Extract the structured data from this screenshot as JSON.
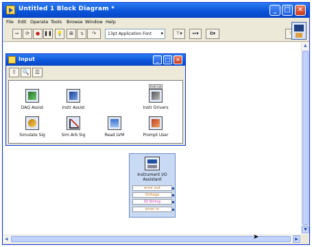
{
  "window": {
    "title": "Untitled 1 Block Diagram *",
    "controls": {
      "minimize": "_",
      "maximize": "□",
      "close": "✕"
    }
  },
  "menubar": [
    "File",
    "Edit",
    "Operate",
    "Tools",
    "Browse",
    "Window",
    "Help"
  ],
  "toolbar": {
    "font_select": "13pt Application Font"
  },
  "palette": {
    "title": "Input",
    "controls": {
      "minimize": "_",
      "maximize": "□",
      "close": "✕"
    },
    "items": [
      {
        "label": "DAQ Assist",
        "icon": "daq-assistant-icon"
      },
      {
        "label": "Instr Assist",
        "icon": "instrument-assistant-icon"
      },
      {
        "label": "Instr Drivers",
        "icon": "instrument-drivers-icon",
        "tag": "Instr Lib"
      },
      {
        "label": "Simulate Sig",
        "icon": "simulate-signal-icon"
      },
      {
        "label": "Sim Arb Sig",
        "icon": "simulate-arbitrary-signal-icon"
      },
      {
        "label": "Read LVM",
        "icon": "read-lvm-icon"
      },
      {
        "label": "Prompt User",
        "icon": "prompt-user-icon"
      }
    ]
  },
  "node": {
    "title_line1": "Instrument I/O",
    "title_line2": "Assistant",
    "terminals": [
      {
        "label": "error out",
        "color": "#b5742a"
      },
      {
        "label": "Voltage",
        "color": "#d07a1a"
      },
      {
        "label": "ID String",
        "color": "#cc33aa"
      },
      {
        "label": "error in",
        "color": "#b5742a"
      }
    ]
  }
}
